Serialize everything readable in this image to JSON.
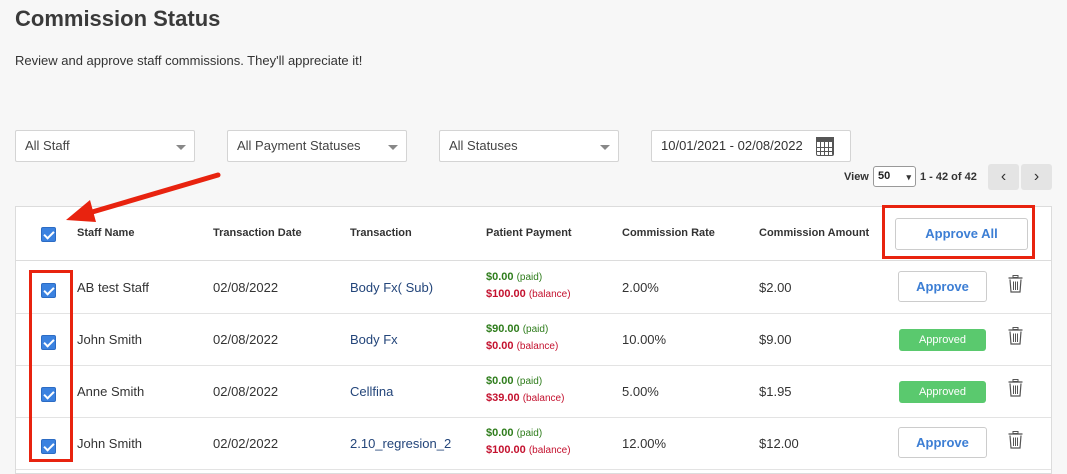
{
  "header": {
    "title": "Commission Status",
    "subtitle": "Review and approve staff commissions. They'll appreciate it!"
  },
  "filters": {
    "staff": "All Staff",
    "payment_status": "All Payment Statuses",
    "status": "All Statuses",
    "date_range": "10/01/2021 - 02/08/2022"
  },
  "pager": {
    "view_label": "View",
    "per_page": "50",
    "range": "1 - 42 of 42",
    "prev": "‹",
    "next": "›"
  },
  "table": {
    "columns": [
      "Staff Name",
      "Transaction Date",
      "Transaction",
      "Patient Payment",
      "Commission Rate",
      "Commission Amount"
    ],
    "approve_all_label": "Approve All",
    "paid_suffix": "(paid)",
    "balance_suffix": "(balance)",
    "rows": [
      {
        "staff": "AB test Staff",
        "date": "02/08/2022",
        "transaction": "Body Fx( Sub)",
        "paid": "$0.00",
        "balance": "$100.00",
        "rate": "2.00%",
        "amount": "$2.00",
        "status": "Approve"
      },
      {
        "staff": "John Smith",
        "date": "02/08/2022",
        "transaction": "Body Fx",
        "paid": "$90.00",
        "balance": "$0.00",
        "rate": "10.00%",
        "amount": "$9.00",
        "status": "Approved"
      },
      {
        "staff": "Anne Smith",
        "date": "02/08/2022",
        "transaction": "Cellfina",
        "paid": "$0.00",
        "balance": "$39.00",
        "rate": "5.00%",
        "amount": "$1.95",
        "status": "Approved"
      },
      {
        "staff": "John Smith",
        "date": "02/02/2022",
        "transaction": "2.10_regresion_2",
        "paid": "$0.00",
        "balance": "$100.00",
        "rate": "12.00%",
        "amount": "$12.00",
        "status": "Approve"
      }
    ]
  },
  "colors": {
    "accent": "#3c7ed4",
    "approved": "#5ac96e",
    "paid": "#2f7d1c",
    "balance": "#c4122f",
    "highlight": "#e8230f"
  }
}
